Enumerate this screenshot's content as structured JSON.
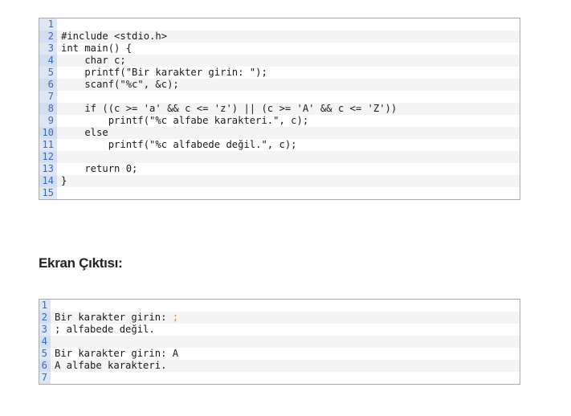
{
  "code_block": {
    "line_numbers": [
      "1",
      "2",
      "3",
      "4",
      "5",
      "6",
      "7",
      "8",
      "9",
      "10",
      "11",
      "12",
      "13",
      "14",
      "15"
    ],
    "lines": [
      "",
      "#include <stdio.h>",
      "int main() {",
      "    char c;",
      "    printf(\"Bir karakter girin: \");",
      "    scanf(\"%c\", &c);",
      "",
      "    if ((c >= 'a' && c <= 'z') || (c >= 'A' && c <= 'Z'))",
      "        printf(\"%c alfabe karakteri.\", c);",
      "    else",
      "        printf(\"%c alfabede değil.\", c);",
      "",
      "    return 0;",
      "}",
      ""
    ]
  },
  "section": {
    "title": "Ekran Çıktısı:"
  },
  "output_block": {
    "line_numbers": [
      "1",
      "2",
      "3",
      "4",
      "5",
      "6",
      "7"
    ],
    "lines": [
      "",
      "Bir karakter girin: ;",
      "; alfabede değil.",
      "",
      "Bir karakter girin: A",
      "A alfabe karakteri.",
      ""
    ]
  }
}
